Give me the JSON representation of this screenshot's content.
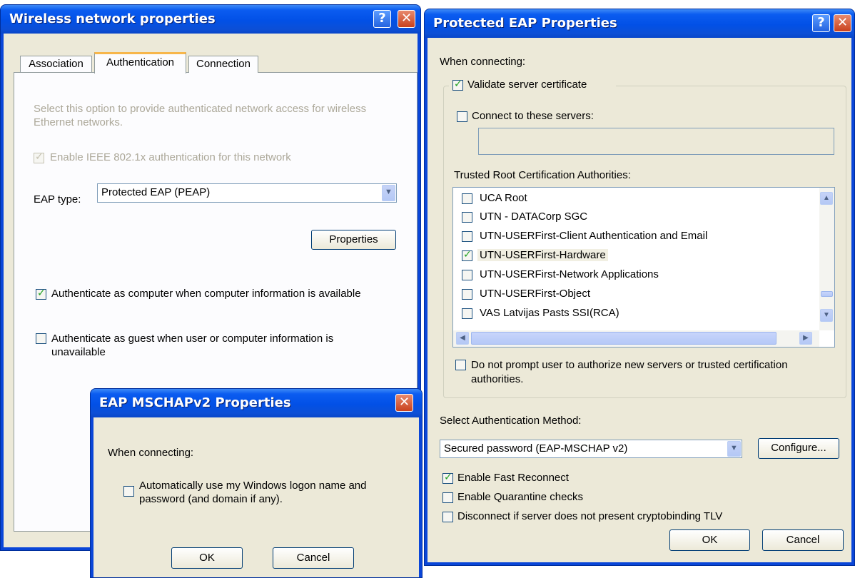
{
  "wireless": {
    "title": "Wireless network properties",
    "help": "?",
    "close": "✕",
    "tabs": [
      "Association",
      "Authentication",
      "Connection"
    ],
    "description": "Select this option to provide authenticated network access for wireless Ethernet networks.",
    "enable_8021x": "Enable IEEE 802.1x authentication for this network",
    "eap_type_label": "EAP type:",
    "eap_type_value": "Protected EAP (PEAP)",
    "properties_button": "Properties",
    "auth_computer": "Authenticate as computer when computer information is available",
    "auth_guest": "Authenticate as guest when user or computer information is unavailable"
  },
  "peap": {
    "title": "Protected EAP Properties",
    "help": "?",
    "close": "✕",
    "when_connecting": "When connecting:",
    "validate_cert": "Validate server certificate",
    "connect_servers": "Connect to these servers:",
    "trusted_label": "Trusted Root Certification Authorities:",
    "cas": [
      {
        "name": "UCA Root",
        "checked": false
      },
      {
        "name": "UTN - DATACorp SGC",
        "checked": false
      },
      {
        "name": "UTN-USERFirst-Client Authentication and Email",
        "checked": false
      },
      {
        "name": "UTN-USERFirst-Hardware",
        "checked": true
      },
      {
        "name": "UTN-USERFirst-Network Applications",
        "checked": false
      },
      {
        "name": "UTN-USERFirst-Object",
        "checked": false
      },
      {
        "name": "VAS Latvijas Pasts SSI(RCA)",
        "checked": false
      }
    ],
    "no_prompt": "Do not prompt user to authorize new servers or trusted certification authorities.",
    "select_method_label": "Select Authentication Method:",
    "method_value": "Secured password (EAP-MSCHAP v2)",
    "configure_button": "Configure...",
    "fast_reconnect": "Enable Fast Reconnect",
    "quarantine": "Enable Quarantine checks",
    "cryptobinding": "Disconnect if server does not present cryptobinding TLV",
    "ok": "OK",
    "cancel": "Cancel"
  },
  "mschap": {
    "title": "EAP MSCHAPv2 Properties",
    "close": "✕",
    "when_connecting": "When connecting:",
    "auto_logon": "Automatically use my Windows logon name and password (and domain if any).",
    "ok": "OK",
    "cancel": "Cancel"
  }
}
